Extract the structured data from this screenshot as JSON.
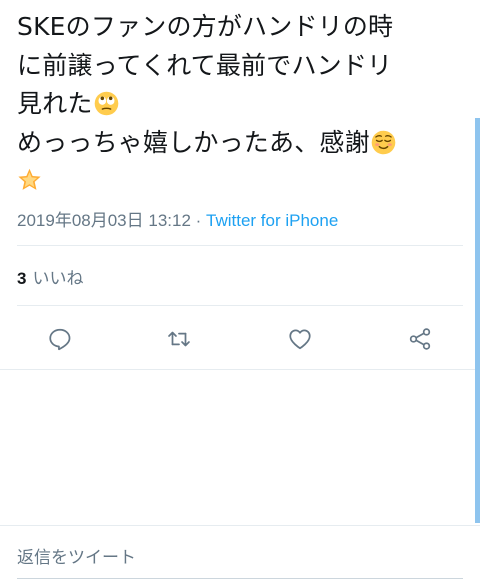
{
  "tweet": {
    "lines": [
      "SKEのファンの方がハンドリの時",
      "に前譲ってくれて最前でハンドリ",
      "見れた",
      "めっっちゃ嬉しかったあ、感謝",
      ""
    ],
    "emojis": {
      "line3": "eyes-rolling-emoji",
      "line4": "relieved-face-emoji",
      "line5": "star-emoji"
    },
    "timestamp": "2019年08月03日 13:12",
    "separator": " · ",
    "source": "Twitter for iPhone"
  },
  "likes": {
    "count": "3",
    "label": "いいね"
  },
  "actions": [
    {
      "icon": "reply-icon"
    },
    {
      "icon": "retweet-icon"
    },
    {
      "icon": "like-icon"
    },
    {
      "icon": "share-icon"
    }
  ],
  "reply": {
    "placeholder": "返信をツイート"
  },
  "colors": {
    "text": "#14171a",
    "secondary": "#657786",
    "link": "#1da1f2",
    "divider": "#e6ecf0",
    "icon": "#657786"
  }
}
